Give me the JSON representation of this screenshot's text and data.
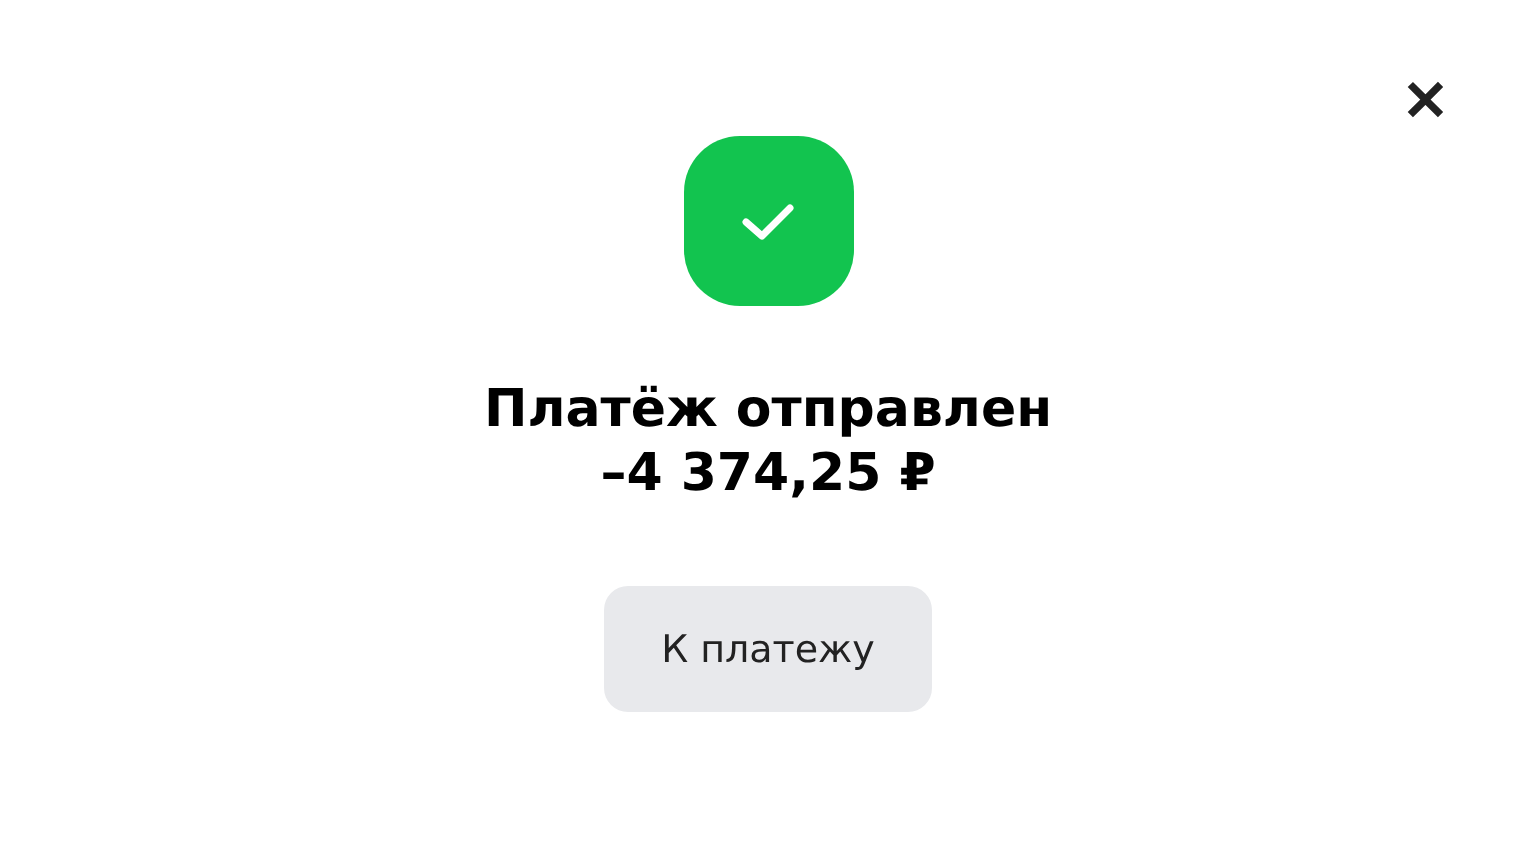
{
  "close": {
    "symbol": "✕"
  },
  "status": {
    "kind": "success",
    "color": "#12c44f"
  },
  "title": "Платёж отправлен",
  "amount": "–4 374,25 ₽",
  "button": "К платежу"
}
